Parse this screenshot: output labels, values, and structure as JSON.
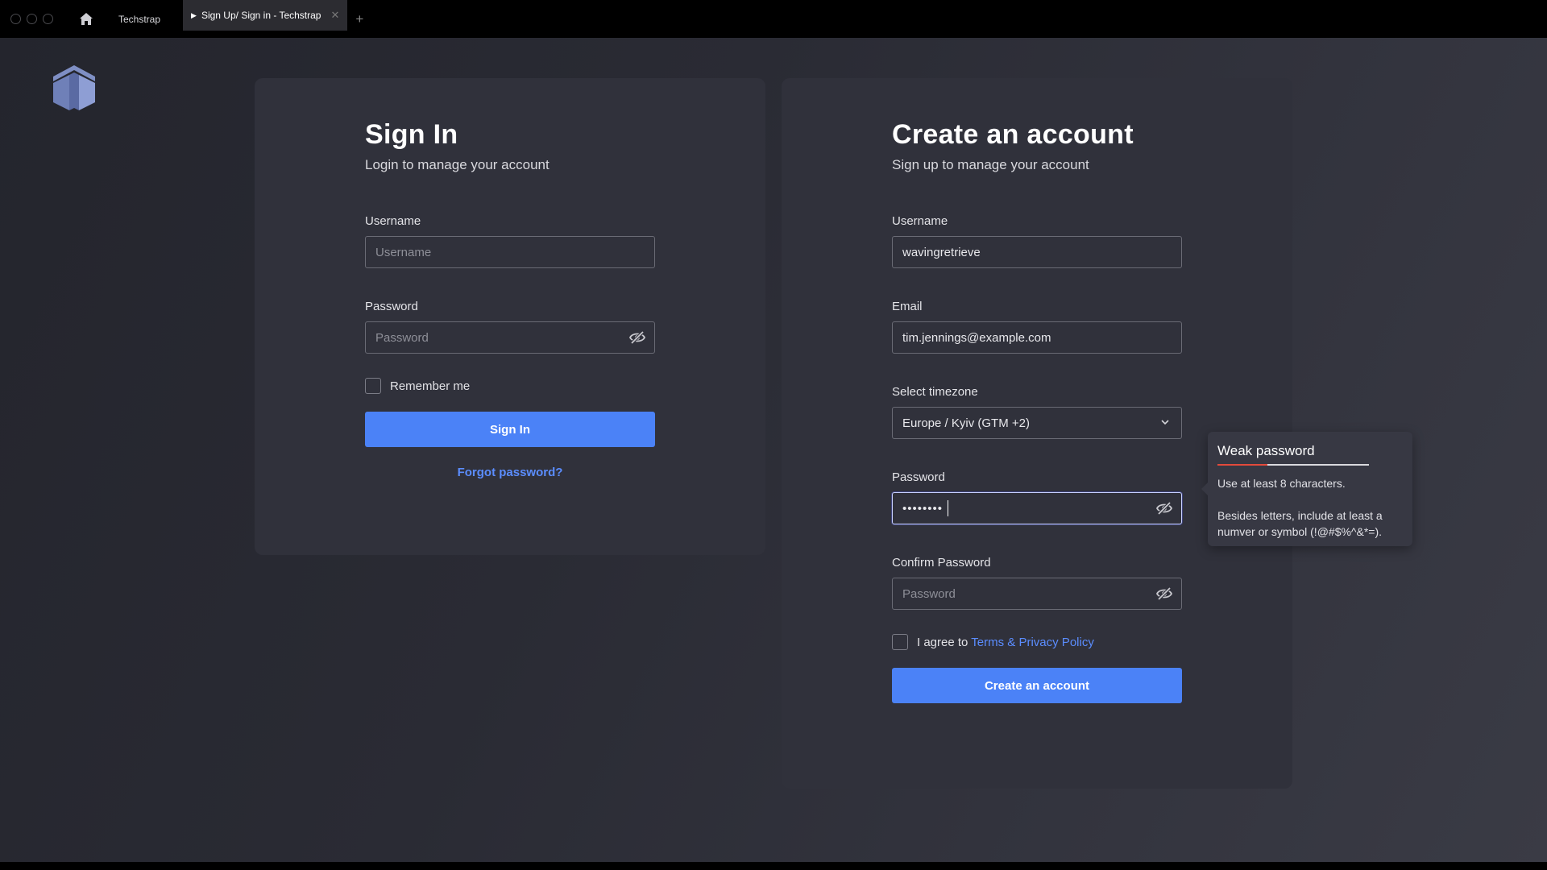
{
  "browser": {
    "tabs": [
      {
        "label": "Techstrap"
      },
      {
        "label": "Sign Up/ Sign in - Techstrap",
        "active": true
      }
    ],
    "new_tab_label": "+"
  },
  "signin": {
    "title": "Sign In",
    "subtitle": "Login to manage your account",
    "username_label": "Username",
    "username_placeholder": "Username",
    "password_label": "Password",
    "password_placeholder": "Password",
    "remember_label": "Remember me",
    "submit_label": "Sign In",
    "forgot_label": "Forgot password?"
  },
  "signup": {
    "title": "Create an account",
    "subtitle": "Sign up to manage your account",
    "username_label": "Username",
    "username_value": "wavingretrieve",
    "email_label": "Email",
    "email_value": "tim.jennings@example.com",
    "timezone_label": "Select timezone",
    "timezone_value": "Europe / Kyiv (GTM +2)",
    "password_label": "Password",
    "password_value": "••••••••",
    "confirm_label": "Confirm Password",
    "confirm_placeholder": "Password",
    "agree_prefix": "I agree to",
    "agree_link": "Terms & Privacy Policy",
    "submit_label": "Create an account"
  },
  "tooltip": {
    "title": "Weak password",
    "strength_fraction": 0.33,
    "line1": "Use at least 8 characters.",
    "line2": "Besides letters, include at least a numver or symbol (!@#$%^&*=)."
  },
  "colors": {
    "accent": "#4b82f7",
    "link": "#5b8dff",
    "weak": "#e34a3b",
    "card": "#30313b"
  }
}
